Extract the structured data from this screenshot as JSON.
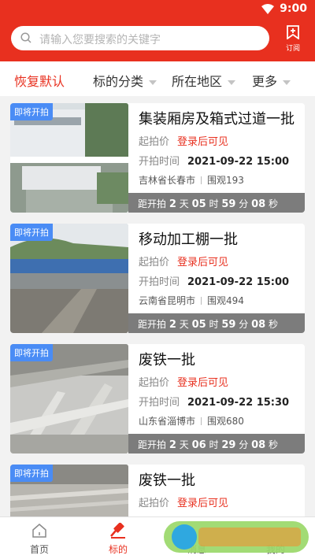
{
  "status": {
    "time": "9:00"
  },
  "search": {
    "placeholder": "请输入您要搜索的关键字"
  },
  "subscribe": {
    "label": "订阅"
  },
  "filters": [
    {
      "label": "恢复默认",
      "active": true
    },
    {
      "label": "标的分类"
    },
    {
      "label": "所在地区"
    },
    {
      "label": "更多"
    }
  ],
  "labels": {
    "start_price": "起拍价",
    "start_time": "开拍时间",
    "countdown_prefix": "距开拍",
    "login_hint": "登录后可见"
  },
  "cards": [
    {
      "badge": "即将开拍",
      "title": "集装厢房及箱式过道一批",
      "time": "2021-09-22 15:00",
      "location": "吉林省长春市",
      "views": "围观193",
      "cd": {
        "d": "2",
        "h": "05",
        "m": "59",
        "s": "08"
      }
    },
    {
      "badge": "即将开拍",
      "title": "移动加工棚一批",
      "time": "2021-09-22 15:00",
      "location": "云南省昆明市",
      "views": "围观494",
      "cd": {
        "d": "2",
        "h": "05",
        "m": "59",
        "s": "08"
      }
    },
    {
      "badge": "即将开拍",
      "title": "废铁一批",
      "time": "2021-09-22 15:30",
      "location": "山东省淄博市",
      "views": "围观680",
      "cd": {
        "d": "2",
        "h": "06",
        "m": "29",
        "s": "08"
      }
    },
    {
      "badge": "即将开拍",
      "title": "废铁一批",
      "time": "",
      "location": "",
      "views": "",
      "cd": null
    }
  ],
  "units": {
    "d": "天",
    "h": "时",
    "m": "分",
    "s": "秒"
  },
  "tabs": [
    {
      "label": "首页"
    },
    {
      "label": "标的"
    },
    {
      "label": "消息"
    },
    {
      "label": "我的"
    }
  ],
  "colors": {
    "brand": "#e8301f",
    "badge": "#4a8cf5",
    "countdown": "#7c7c7c"
  }
}
